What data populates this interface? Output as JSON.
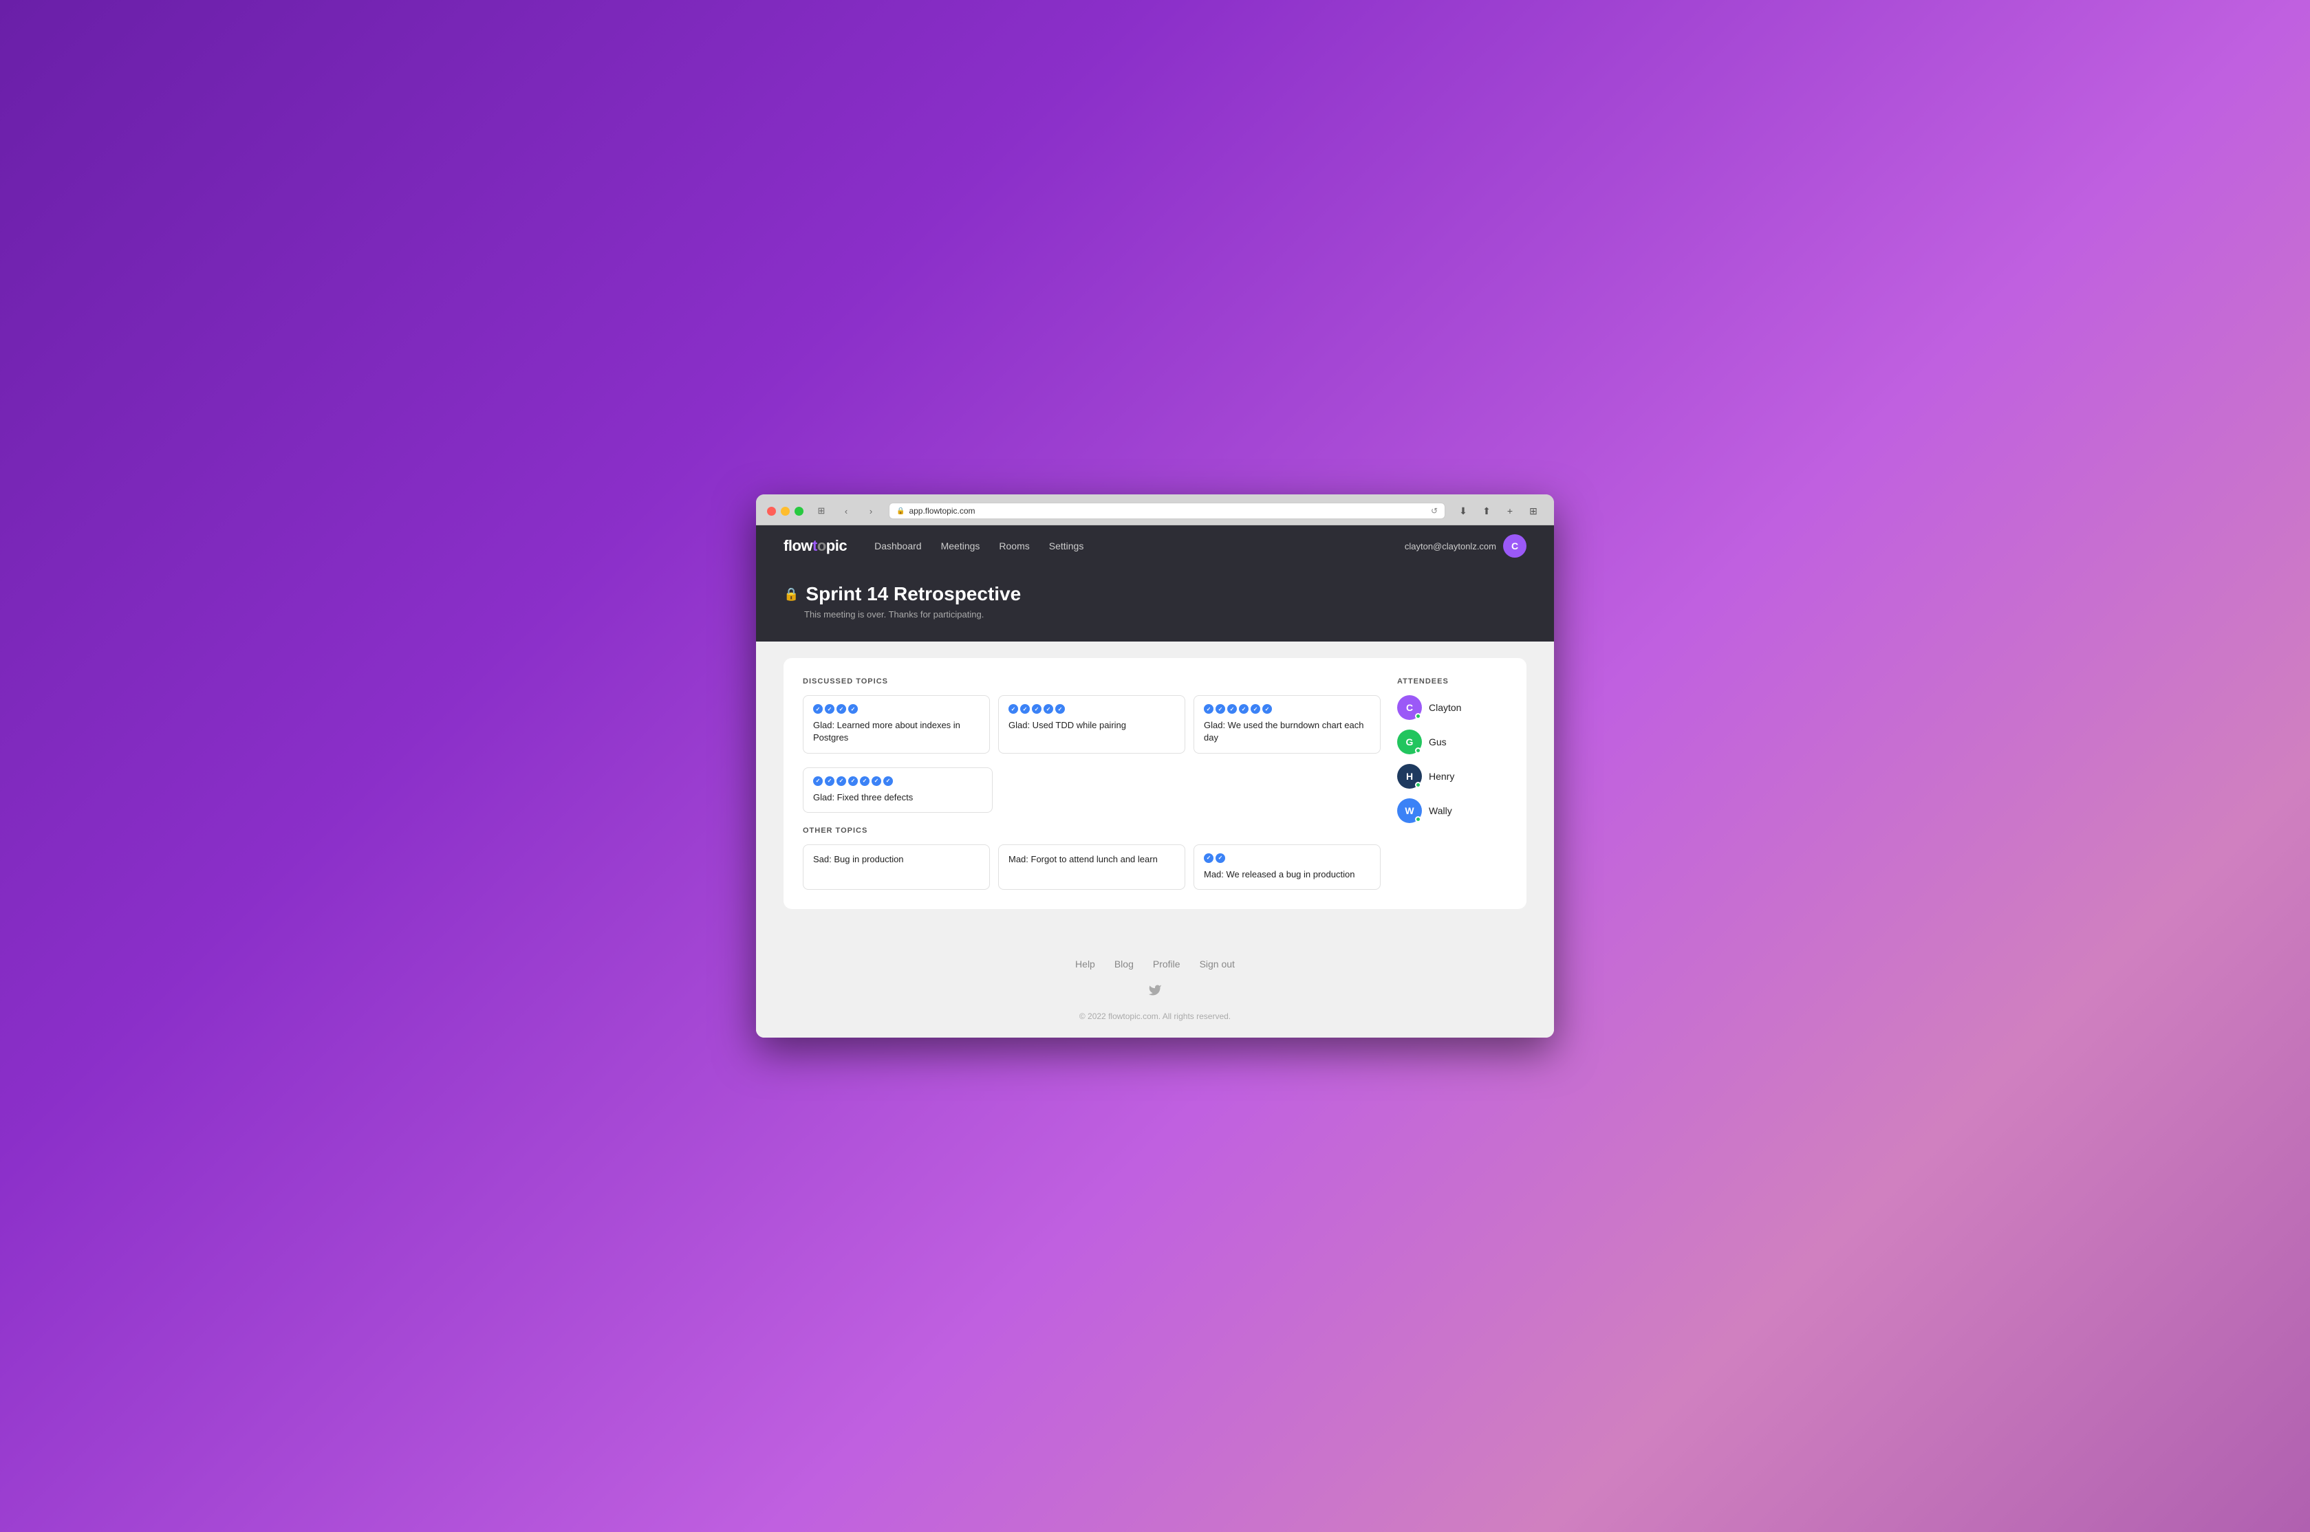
{
  "browser": {
    "url": "app.flowtopic.com",
    "reload_icon": "↺"
  },
  "nav": {
    "logo_part1": "flow",
    "logo_highlight": "t",
    "logo_part2": "pic",
    "links": [
      {
        "label": "Dashboard"
      },
      {
        "label": "Meetings"
      },
      {
        "label": "Rooms"
      },
      {
        "label": "Settings"
      }
    ],
    "user_email": "clayton@claytonlz.com",
    "user_initial": "C"
  },
  "page": {
    "title": "Sprint 14 Retrospective",
    "subtitle": "This meeting is over. Thanks for participating."
  },
  "sections": {
    "discussed_label": "DISCUSSED TOPICS",
    "other_label": "OTHER TOPICS"
  },
  "discussed_topics": [
    {
      "text": "Glad: Learned more about indexes in Postgres",
      "votes": 4
    },
    {
      "text": "Glad: Used TDD while pairing",
      "votes": 5
    },
    {
      "text": "Glad: We used the burndown chart each day",
      "votes": 6
    },
    {
      "text": "Glad: Fixed three defects",
      "votes": 7
    }
  ],
  "other_topics": [
    {
      "text": "Sad: Bug in production",
      "votes": 0
    },
    {
      "text": "Mad: Forgot to attend lunch and learn",
      "votes": 0
    },
    {
      "text": "Mad: We released a bug in production",
      "votes": 2
    }
  ],
  "attendees_label": "ATTENDEES",
  "attendees": [
    {
      "name": "Clayton",
      "initial": "C",
      "color": "#9b59f7",
      "online": true
    },
    {
      "name": "Gus",
      "initial": "G",
      "color": "#22c55e",
      "online": true
    },
    {
      "name": "Henry",
      "initial": "H",
      "color": "#1e3a5f",
      "online": true
    },
    {
      "name": "Wally",
      "initial": "W",
      "color": "#3b82f6",
      "online": true
    }
  ],
  "footer": {
    "links": [
      "Help",
      "Blog",
      "Profile",
      "Sign out"
    ],
    "copyright": "© 2022 flowtopic.com. All rights reserved."
  }
}
